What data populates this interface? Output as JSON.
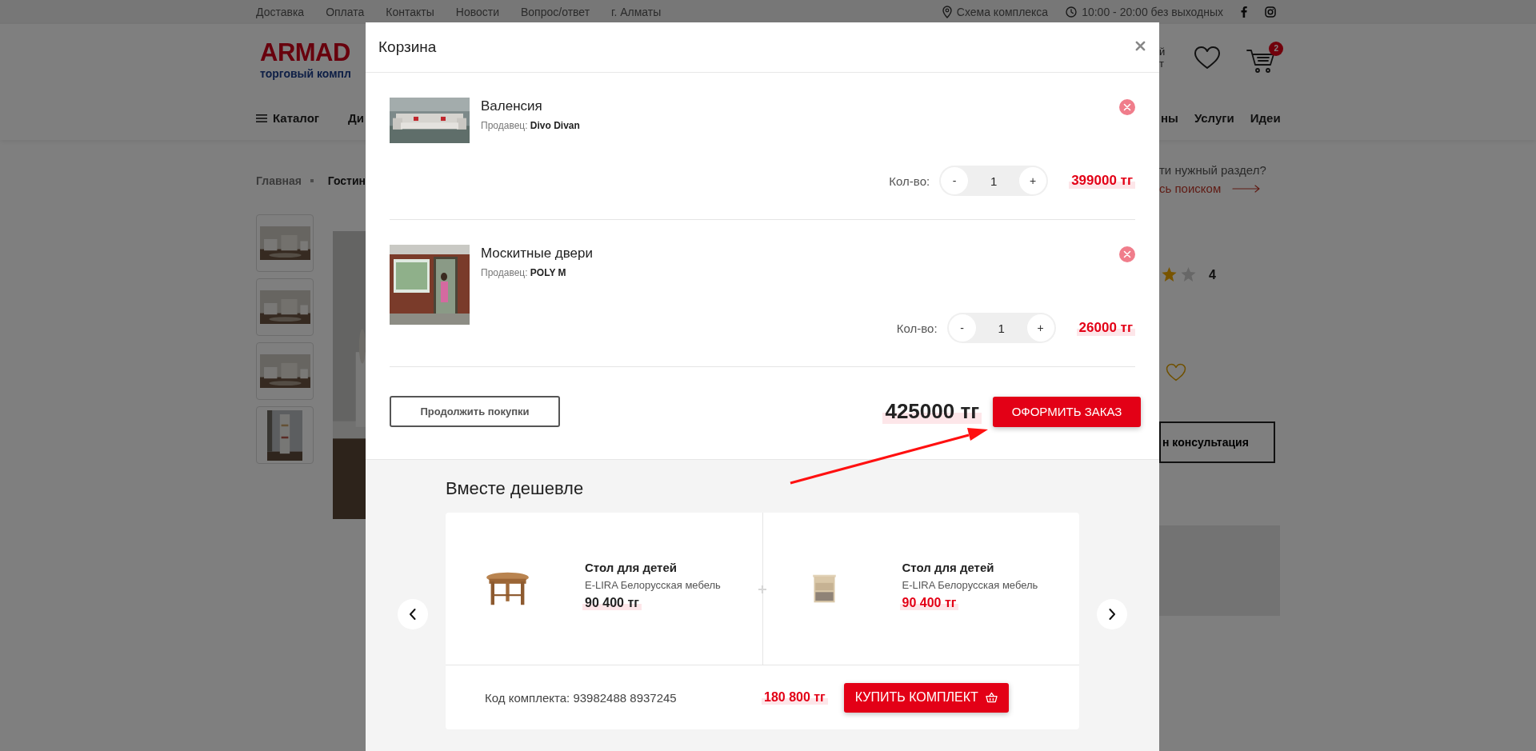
{
  "top_bar": {
    "links": [
      "Доставка",
      "Оплата",
      "Контакты",
      "Новости",
      "Вопрос/ответ",
      "г. Алматы"
    ],
    "map_link": "Схема комплекса",
    "hours": "10:00 - 20:00 без выходных"
  },
  "header": {
    "logo": "ARMAD",
    "logo_subtitle": "торговый компл",
    "account_partial": [
      "й",
      "т"
    ],
    "cart_count": "2"
  },
  "nav": {
    "left": [
      {
        "label": "Каталог",
        "kind": "menu"
      },
      {
        "label": "Ди",
        "kind": "link"
      }
    ],
    "right": [
      "ны",
      "Услуги",
      "Идеи"
    ]
  },
  "breadcrumb": [
    "Главная",
    "Гостин"
  ],
  "gallery": {
    "thumbnails": [
      {
        "kind": "picture"
      },
      {
        "kind": "picture"
      },
      {
        "kind": "picture"
      },
      {
        "kind": "picture"
      }
    ],
    "main": {
      "kind": "picture"
    }
  },
  "sidebar": {
    "search_hint": "ти нужный раздел?",
    "search_link": "сь поиском",
    "rating": {
      "visible_stars": [
        {
          "filled": true
        },
        {
          "filled": false
        }
      ],
      "count": "4"
    },
    "consult_button": "н консультация"
  },
  "modal": {
    "title": "Корзина",
    "items": [
      {
        "name": "Валенсия",
        "seller_label": "Продавец:",
        "seller": "Divo Divan",
        "qty_label": "Кол-во:",
        "minus": "-",
        "quantity": "1",
        "plus": "+",
        "price": "399000 тг"
      },
      {
        "name": "Москитные двери",
        "seller_label": "Продавец:",
        "seller": "POLY M",
        "qty_label": "Кол-во:",
        "minus": "-",
        "quantity": "1",
        "plus": "+",
        "price": "26000 тг"
      }
    ],
    "continue_button": "Продолжить покупки",
    "total": "425000 тг",
    "checkout_button": "ОФОРМИТЬ ЗАКАЗ",
    "bundle": {
      "title": "Вместе дешевле",
      "products": [
        {
          "name": "Стол для детей",
          "seller": "E-LIRA Белорусская мебель",
          "price": "90 400 тг",
          "color": "#222222"
        },
        {
          "name": "Стол для детей",
          "seller": "E-LIRA Белорусская мебель",
          "price": "90 400 тг",
          "color": "#e30016"
        }
      ],
      "code": "Код комплекта: 93982488 8937245",
      "price": "180 800 тг",
      "buy_button": "КУПИТЬ КОМПЛЕКТ"
    }
  }
}
